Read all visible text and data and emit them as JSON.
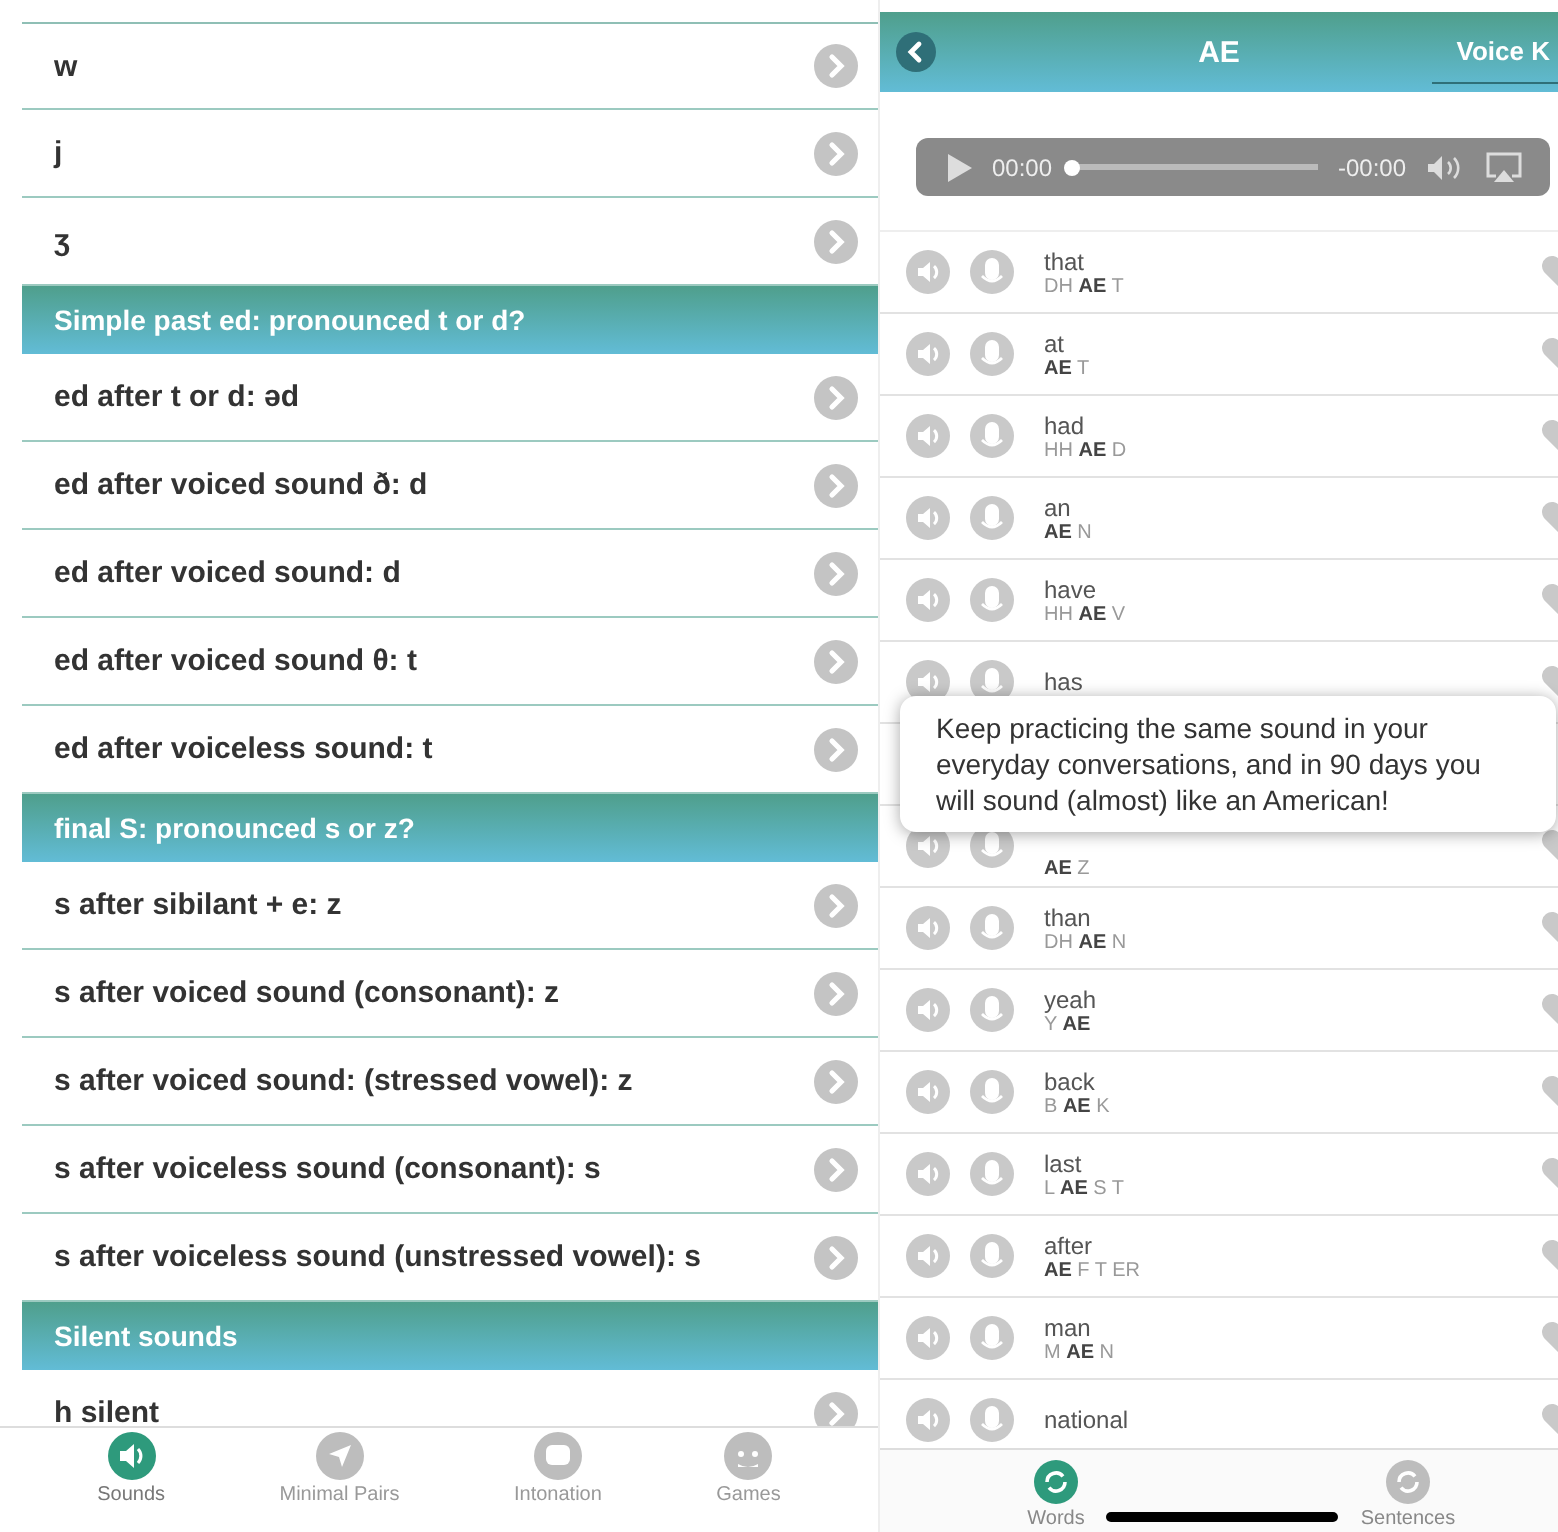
{
  "sounds_list": {
    "items": [
      {
        "kind": "row",
        "label": "w"
      },
      {
        "kind": "row",
        "label": "j"
      },
      {
        "kind": "row",
        "label": "ʒ"
      },
      {
        "kind": "header",
        "label": "Simple past ed: pronounced t or d?"
      },
      {
        "kind": "row",
        "label": "ed after t or d: əd"
      },
      {
        "kind": "row",
        "label": "ed after voiced sound ð: d"
      },
      {
        "kind": "row",
        "label": "ed after voiced sound: d"
      },
      {
        "kind": "row",
        "label": "ed after voiced sound θ: t"
      },
      {
        "kind": "row",
        "label": "ed after voiceless sound: t"
      },
      {
        "kind": "header",
        "label": "final S: pronounced s or z?"
      },
      {
        "kind": "row",
        "label": "s after sibilant + e: z"
      },
      {
        "kind": "row",
        "label": "s after voiced sound (consonant): z"
      },
      {
        "kind": "row",
        "label": "s after voiced sound: (stressed vowel): z"
      },
      {
        "kind": "row",
        "label": "s after voiceless sound (consonant): s"
      },
      {
        "kind": "row",
        "label": "s after voiceless sound (unstressed vowel): s"
      },
      {
        "kind": "header",
        "label": "Silent sounds"
      },
      {
        "kind": "row",
        "label": "h silent"
      }
    ]
  },
  "left_tab_bar": [
    {
      "label": "Sounds",
      "selected": true
    },
    {
      "label": "Minimal Pairs",
      "selected": false
    },
    {
      "label": "Intonation",
      "selected": false
    },
    {
      "label": "Games",
      "selected": false
    }
  ],
  "word_screen": {
    "title": "AE",
    "voice_tab": "Voice K",
    "player": {
      "elapsed": "00:00",
      "remaining": "-00:00",
      "level": 0
    },
    "words": [
      {
        "kind": "word",
        "word": "that",
        "pron": "DH **AE** T"
      },
      {
        "kind": "word",
        "word": "at",
        "pron": "**AE** T"
      },
      {
        "kind": "word",
        "word": "had",
        "pron": "HH **AE** D"
      },
      {
        "kind": "word",
        "word": "an",
        "pron": "**AE** N"
      },
      {
        "kind": "word",
        "word": "have",
        "pron": "HH **AE** V"
      },
      {
        "kind": "word_only",
        "word": "has"
      },
      {
        "kind": "covered"
      },
      {
        "kind": "pron_only",
        "pron": "**AE** Z"
      },
      {
        "kind": "word",
        "word": "than",
        "pron": "DH **AE** N"
      },
      {
        "kind": "word",
        "word": "yeah",
        "pron": "Y **AE**"
      },
      {
        "kind": "word",
        "word": "back",
        "pron": "B **AE** K"
      },
      {
        "kind": "word",
        "word": "last",
        "pron": "L **AE** S T"
      },
      {
        "kind": "word",
        "word": "after",
        "pron": "**AE** F T ER"
      },
      {
        "kind": "word",
        "word": "man",
        "pron": "M **AE** N"
      },
      {
        "kind": "word",
        "word": "national"
      }
    ],
    "tooltip": "Keep practicing the same sound in your everyday conversations, and in 90 days you will sound (almost) like an American!",
    "tab_bar": [
      {
        "label": "Words",
        "selected": true
      },
      {
        "label": "Sentences",
        "selected": false
      }
    ]
  }
}
